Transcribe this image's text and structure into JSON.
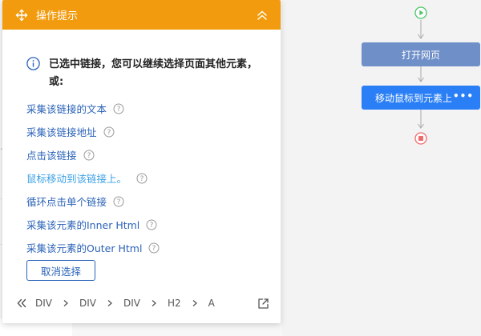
{
  "panel": {
    "title": "操作提示",
    "info_text": "已选中链接，您可以继续选择页面其他元素，或:",
    "actions": [
      {
        "label": "采集该链接的文本"
      },
      {
        "label": "采集该链接地址"
      },
      {
        "label": "点击该链接"
      },
      {
        "label": "鼠标移动到该链接上。"
      },
      {
        "label": "循环点击单个链接"
      },
      {
        "label": "采集该元素的Inner Html"
      },
      {
        "label": "采集该元素的Outer Html"
      }
    ],
    "cancel_label": "取消选择",
    "breadcrumb": [
      "DIV",
      "DIV",
      "DIV",
      "H2",
      "A"
    ],
    "header_color": "#f29b0e",
    "link_color": "#2a62b8"
  },
  "flow": {
    "nodes": [
      {
        "label": "打开网页"
      },
      {
        "label": "移动鼠标到元素上",
        "more": "•••"
      }
    ]
  },
  "icons": [
    "move-icon",
    "collapse-icon",
    "info-icon",
    "help-icon",
    "double-chevron-left-icon",
    "chevron-right-icon",
    "external-link-icon",
    "play-icon",
    "stop-icon",
    "arrow-down-icon"
  ]
}
